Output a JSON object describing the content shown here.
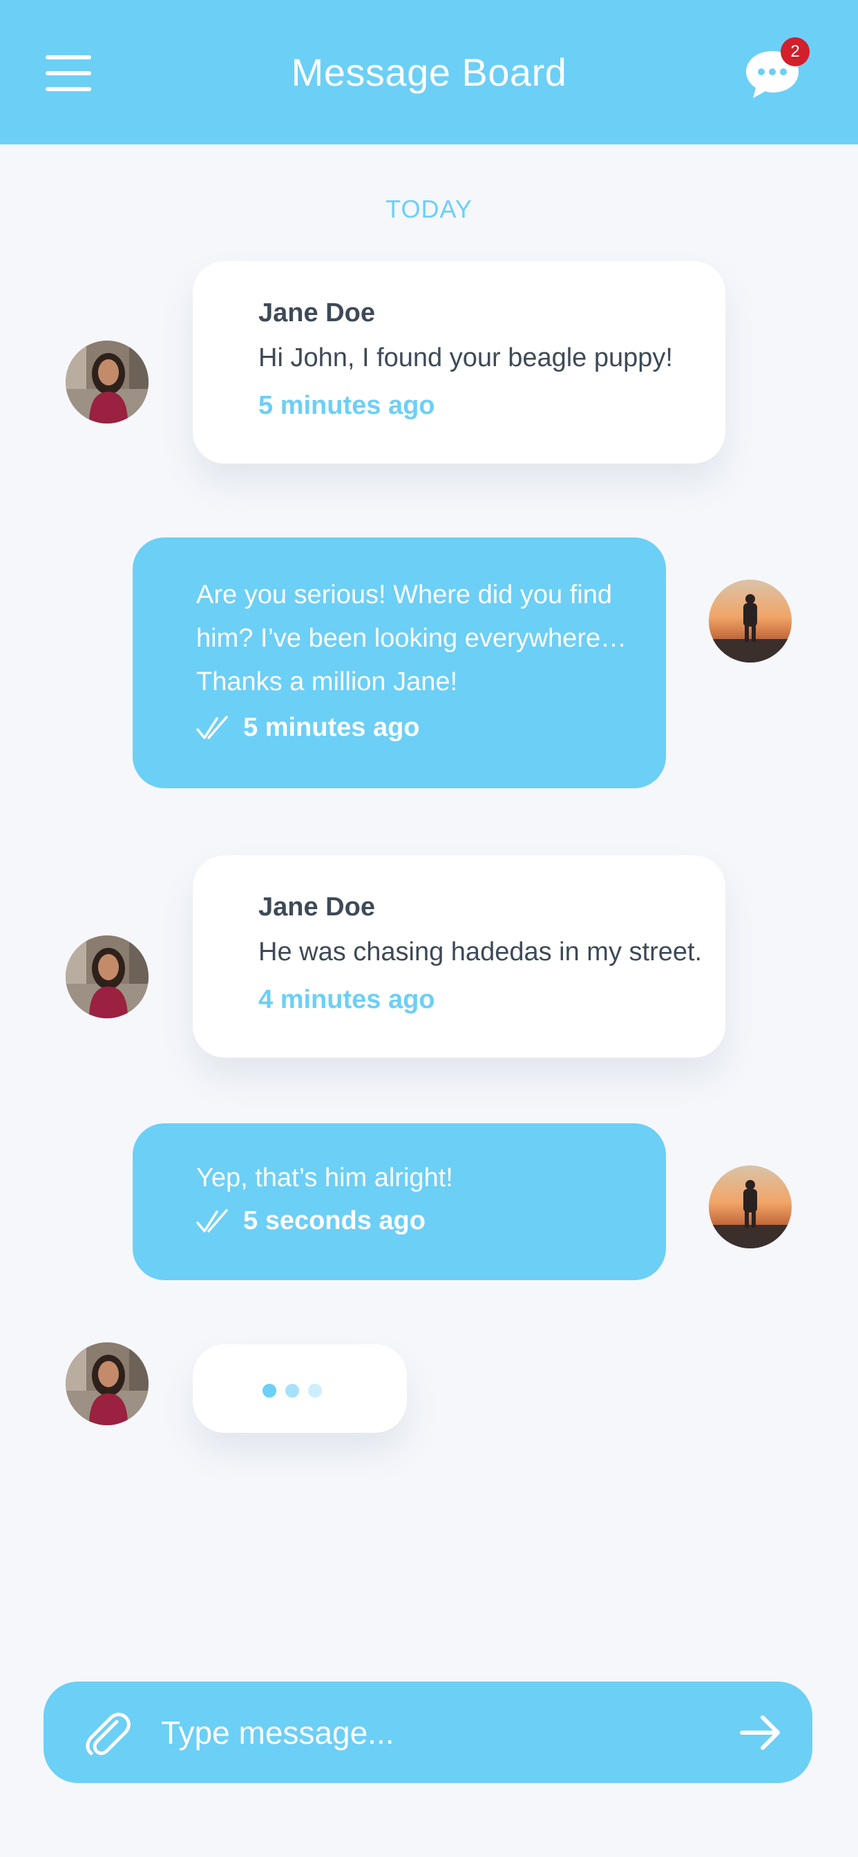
{
  "header": {
    "title": "Message Board",
    "menu_icon": "hamburger-menu-icon",
    "chat_icon": "chat-bubble-icon",
    "notification_count": "2"
  },
  "date_separator": "TODAY",
  "messages": [
    {
      "direction": "incoming",
      "sender": "Jane Doe",
      "text": "Hi John, I found your beagle puppy!",
      "time": "5 minutes ago"
    },
    {
      "direction": "outgoing",
      "lines": [
        "Are you serious! Where did you find",
        "him? I’ve been looking everywhere…",
        "Thanks a million Jane!"
      ],
      "time": "5 minutes ago",
      "status_icon": "double-check-icon"
    },
    {
      "direction": "incoming",
      "sender": "Jane Doe",
      "text": "He was chasing hadedas in my street.",
      "time": "4 minutes ago"
    },
    {
      "direction": "outgoing",
      "lines": [
        "Yep, that’s him alright!"
      ],
      "time": "5 seconds ago",
      "status_icon": "double-check-icon"
    }
  ],
  "typing_indicator": {
    "icon": "typing-dots-icon"
  },
  "composer": {
    "placeholder": "Type message...",
    "attach_icon": "paperclip-icon",
    "send_icon": "arrow-right-icon"
  },
  "colors": {
    "accent": "#6ccff6",
    "background": "#f5f7fb",
    "text_dark": "#3e4a57",
    "badge": "#d21f2b"
  }
}
